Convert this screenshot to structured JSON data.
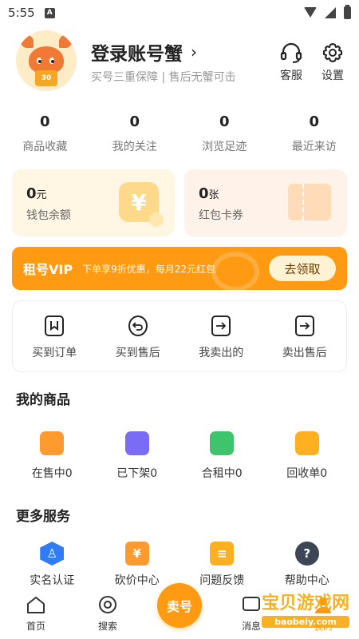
{
  "status_bar": {
    "time": "5:55",
    "notif_letter": "A"
  },
  "profile": {
    "title": "登录账号蟹",
    "chevron": "›",
    "subtitle": "买号三重保障 | 售后无蟹可击",
    "avatar_badge": "30"
  },
  "top_actions": {
    "service_label": "客服",
    "settings_label": "设置"
  },
  "stats": [
    {
      "value": "0",
      "label": "商品收藏"
    },
    {
      "value": "0",
      "label": "我的关注"
    },
    {
      "value": "0",
      "label": "浏览足迹"
    },
    {
      "value": "0",
      "label": "最近来访"
    }
  ],
  "wallet": {
    "balance_value": "0",
    "balance_unit": "元",
    "balance_label": "钱包余额",
    "coupon_value": "0",
    "coupon_unit": "张",
    "coupon_label": "红包卡券",
    "yen_symbol": "¥"
  },
  "vip": {
    "title": "租号VIP",
    "desc": "下单享9折优惠，每月22元红包",
    "button": "去领取"
  },
  "orders": [
    {
      "label": "买到订单",
      "icon": "bookmark-icon"
    },
    {
      "label": "买到售后",
      "icon": "return-icon"
    },
    {
      "label": "我卖出的",
      "icon": "arrow-right-icon"
    },
    {
      "label": "卖出售后",
      "icon": "arrow-right-icon"
    }
  ],
  "goods_section": {
    "title": "我的商品"
  },
  "goods": [
    {
      "label": "在售中0",
      "color": "#ff9a2e"
    },
    {
      "label": "已下架0",
      "color": "#7a6cf5"
    },
    {
      "label": "合租中0",
      "color": "#3ec46d"
    },
    {
      "label": "回收单0",
      "color": "#ffb020"
    }
  ],
  "services_section": {
    "title": "更多服务"
  },
  "services": [
    {
      "label": "实名认证",
      "color": "#2f7cf6",
      "glyph": "♙"
    },
    {
      "label": "砍价中心",
      "color": "#ff9a2e",
      "glyph": "¥"
    },
    {
      "label": "问题反馈",
      "color": "#ffb020",
      "glyph": "≡"
    },
    {
      "label": "帮助中心",
      "color": "#3d4656",
      "glyph": "?"
    }
  ],
  "tabbar": {
    "home": "首页",
    "search": "搜索",
    "sell": "卖号",
    "message": "消息",
    "mine": "我的"
  },
  "watermark": {
    "main": "宝贝游戏网",
    "sub": "baobeiy.com"
  },
  "colors": {
    "accent": "#ff9a12"
  }
}
